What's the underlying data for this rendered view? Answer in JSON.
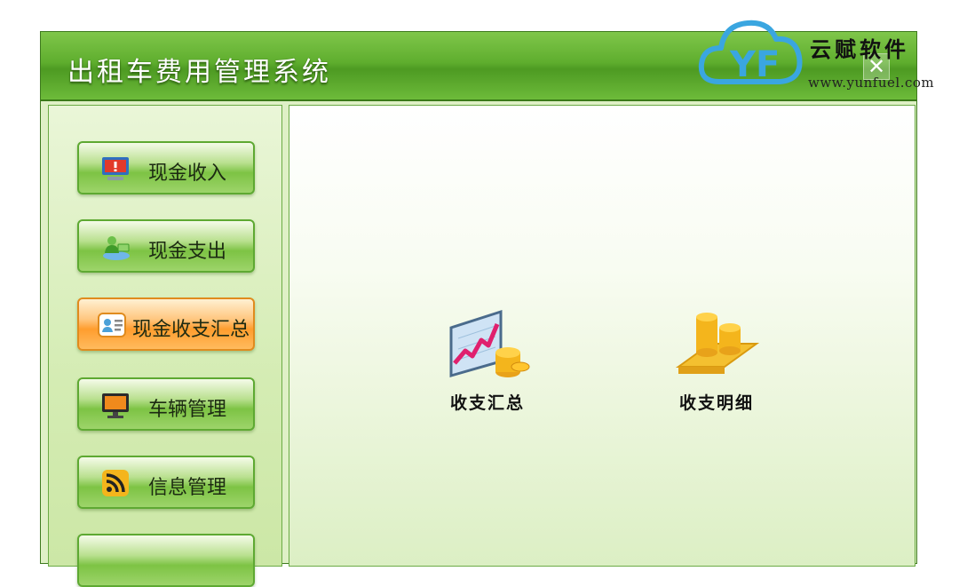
{
  "window": {
    "title": "出租车费用管理系统",
    "close_symbol": "✕"
  },
  "sidebar": {
    "items": [
      {
        "label": "现金收入",
        "icon": "monitor-alert-icon",
        "active": false
      },
      {
        "label": "现金支出",
        "icon": "person-money-icon",
        "active": false
      },
      {
        "label": "现金收支汇总",
        "icon": "contact-card-icon",
        "active": true
      },
      {
        "label": "车辆管理",
        "icon": "computer-monitor-icon",
        "active": false
      },
      {
        "label": "信息管理",
        "icon": "rss-feed-icon",
        "active": false
      }
    ]
  },
  "main": {
    "tiles": [
      {
        "label": "收支汇总",
        "icon": "chart-coins-icon"
      },
      {
        "label": "收支明细",
        "icon": "coin-stacks-icon"
      }
    ]
  },
  "watermark": {
    "brand": "云赋软件",
    "url": "www.yunfuel.com",
    "logo_letters": "YF"
  },
  "colors": {
    "titlebar_green": "#5fae2e",
    "active_orange": "#ff9d2e",
    "logo_blue": "#3aa6e0"
  }
}
